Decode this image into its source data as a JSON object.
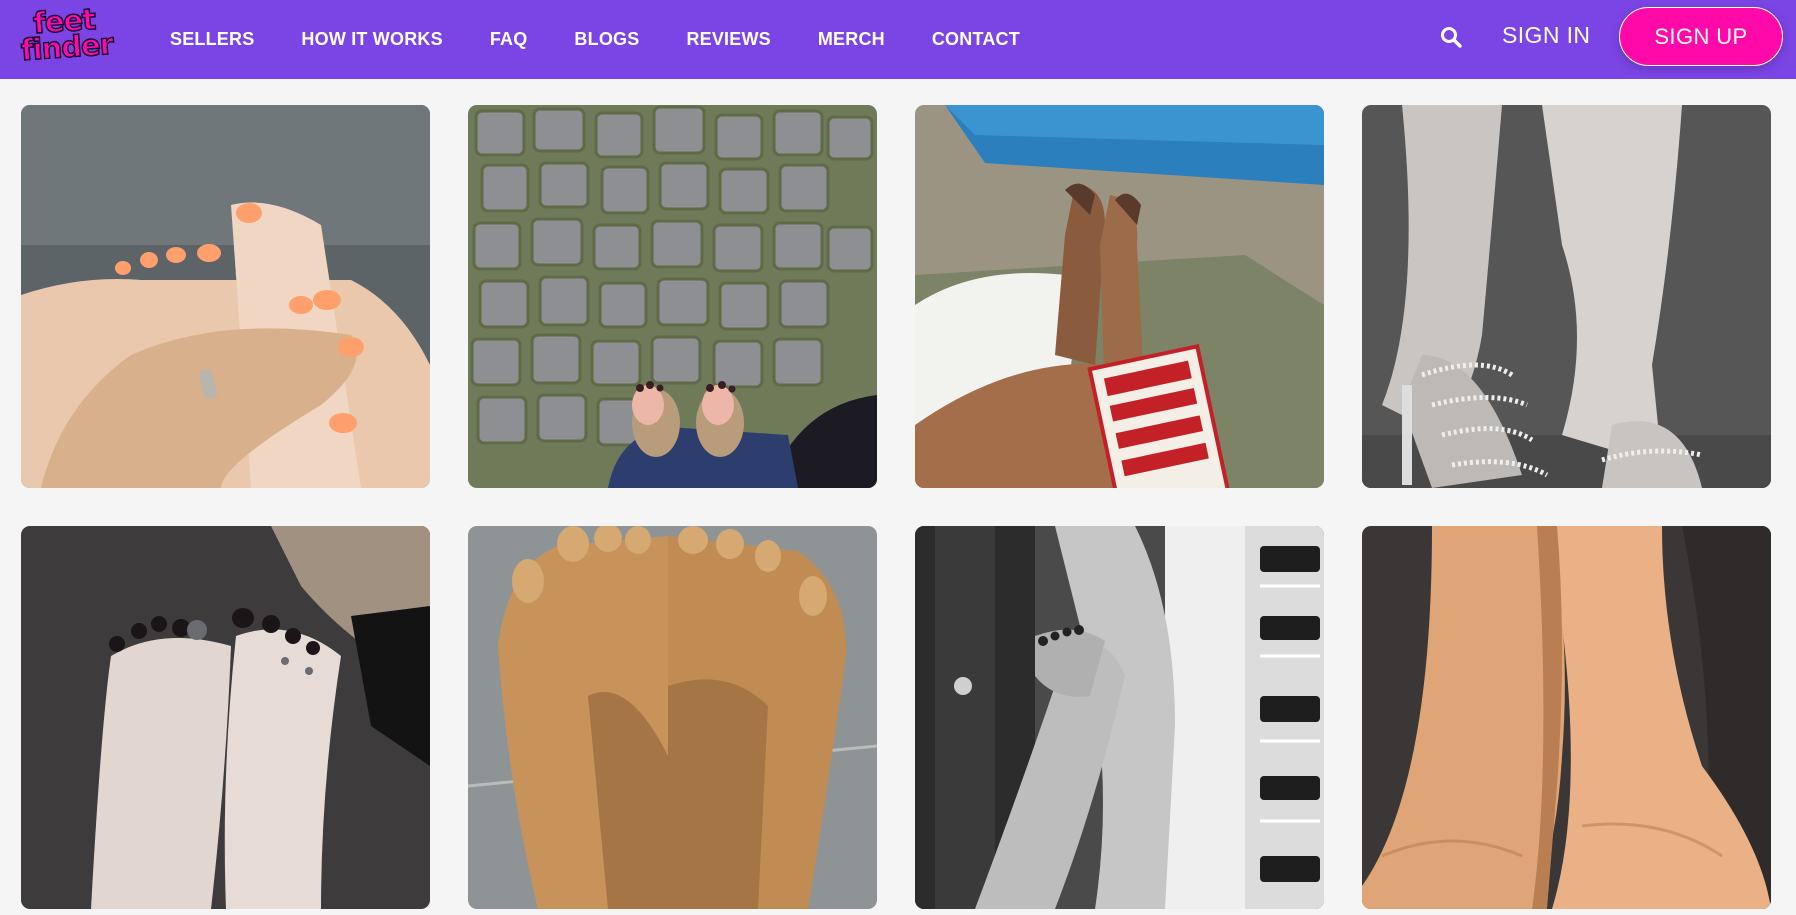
{
  "brand": {
    "logo_line1": "feet",
    "logo_line2": "finder",
    "primary_color": "#7b44e4",
    "accent_color": "#ff0aa8"
  },
  "nav": {
    "items": [
      {
        "label": "SELLERS"
      },
      {
        "label": "HOW IT WORKS"
      },
      {
        "label": "FAQ"
      },
      {
        "label": "BLOGS"
      },
      {
        "label": "REVIEWS"
      },
      {
        "label": "MERCH"
      },
      {
        "label": "CONTACT"
      }
    ]
  },
  "header": {
    "search_icon": "search-icon",
    "signin_label": "SIGN IN",
    "signup_label": "SIGN UP"
  },
  "gallery": {
    "photos": [
      {
        "subject": "feet with orange painted nails beside a hand on grey fur"
      },
      {
        "subject": "feet in sandals on cobblestone pavement"
      },
      {
        "subject": "legs on a lounger by a pool with a book"
      },
      {
        "subject": "feet in silver strappy heels, grayscale"
      },
      {
        "subject": "feet with dark nail polish and toe tattoos"
      },
      {
        "subject": "tanned feet on grey tiles"
      },
      {
        "subject": "crossed legs with dark nails, black and white"
      },
      {
        "subject": "soles of bare feet on dark sofa"
      }
    ]
  }
}
